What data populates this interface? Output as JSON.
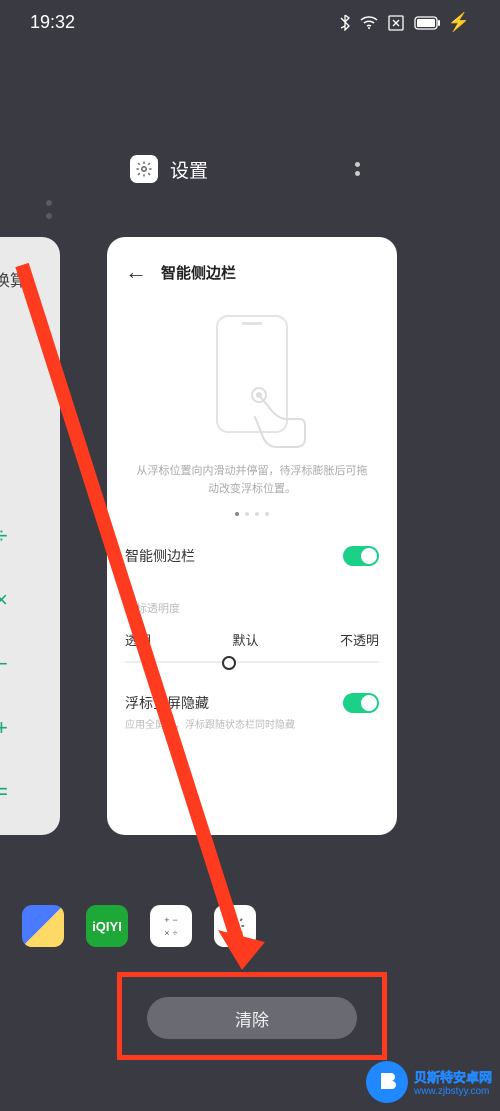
{
  "status": {
    "time": "19:32"
  },
  "app": {
    "title": "设置"
  },
  "left_card": {
    "title": "换算",
    "ops": [
      "÷",
      "×",
      "−",
      "+",
      "="
    ]
  },
  "settings_card": {
    "title": "智能侧边栏",
    "instruction": "从浮标位置向内滑动并停留，待浮标膨胀后可拖动改变浮标位置。",
    "toggle1": "智能侧边栏",
    "opacity_label": "浮标透明度",
    "opacity_options": [
      "透明",
      "默认",
      "不透明"
    ],
    "toggle2": "浮标全屏隐藏",
    "toggle2_sub": "应用全屏时，浮标跟随状态栏同时隐藏"
  },
  "clear_button": "清除",
  "watermark": {
    "line1": "贝斯特安卓网",
    "line2": "www.zjbstyy.com"
  }
}
